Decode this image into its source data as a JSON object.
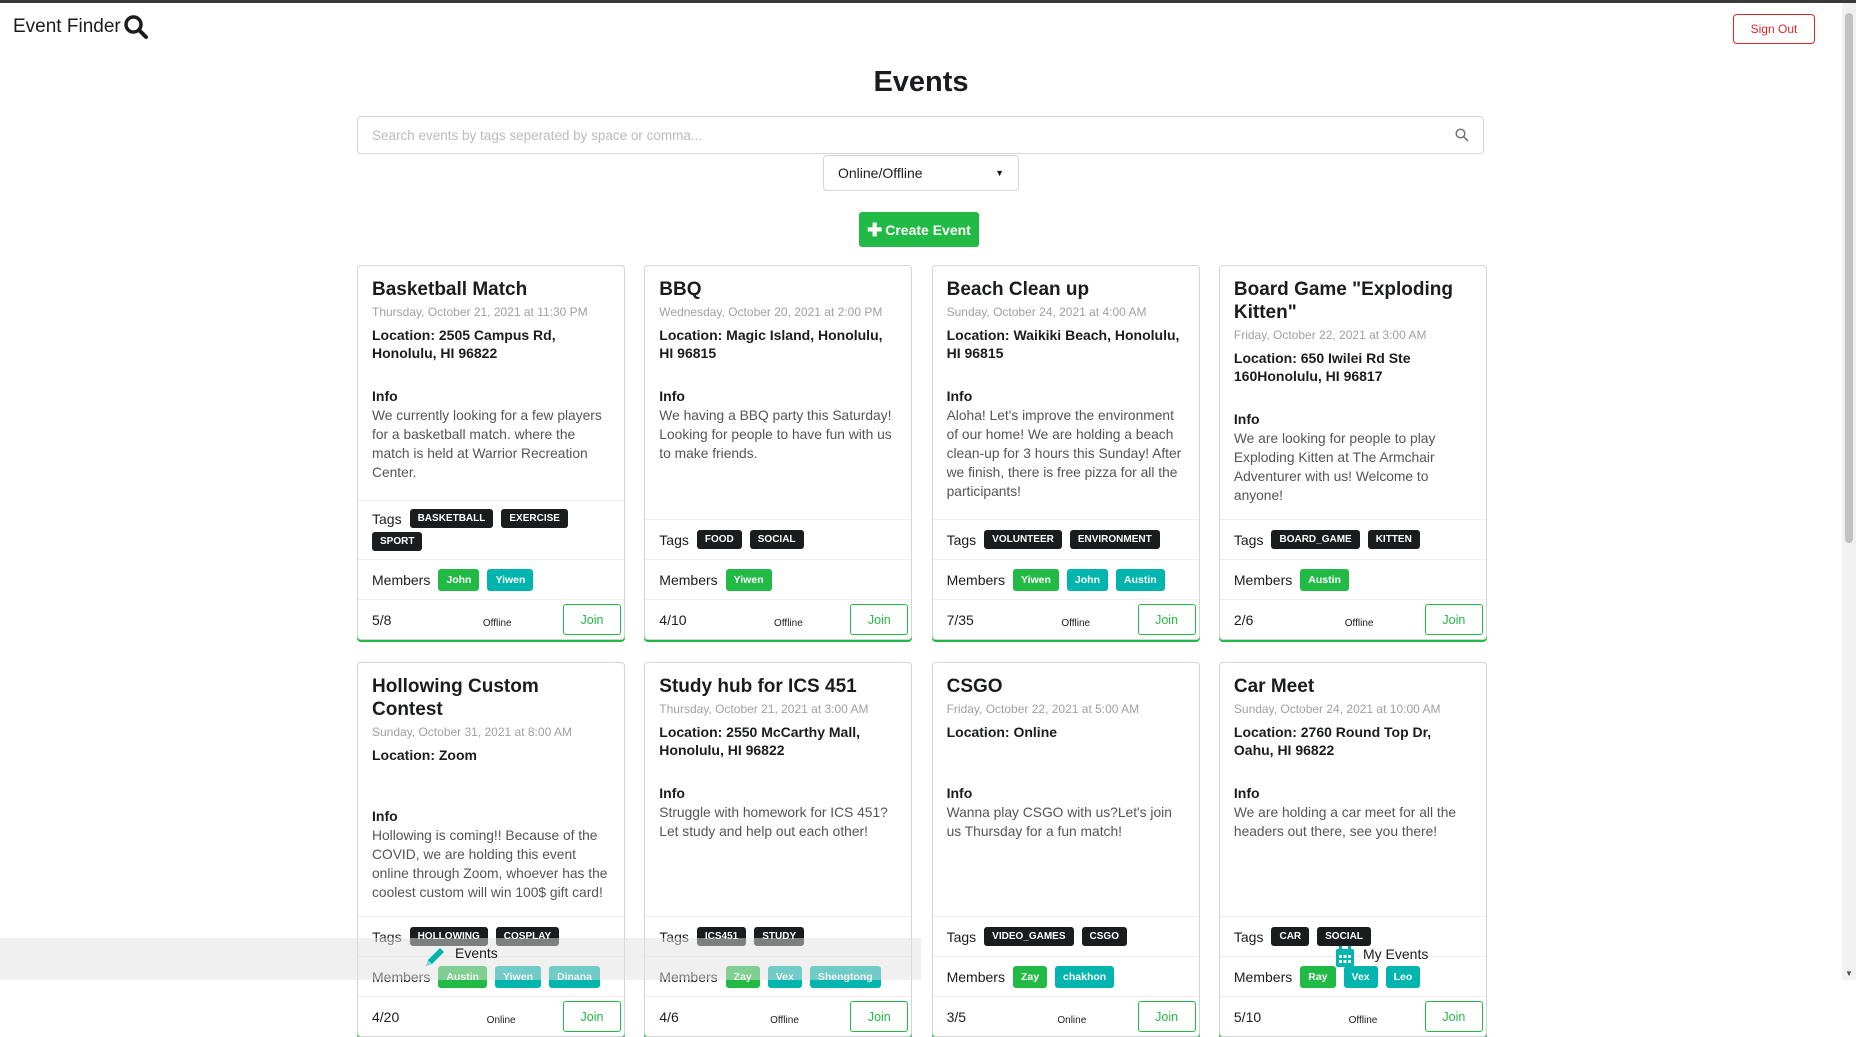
{
  "header": {
    "brand": "Event Finder",
    "sign_out": "Sign Out"
  },
  "page_title": "Events",
  "search": {
    "placeholder": "Search events by tags seperated by space or comma...",
    "value": ""
  },
  "filter": {
    "selected": "Online/Offline"
  },
  "create_button": "Create Event",
  "labels": {
    "info": "Info",
    "tags": "Tags",
    "members": "Members",
    "join": "Join"
  },
  "colors": {
    "green": "#21ba45",
    "teal": "#00b5ad",
    "red": "#db2828",
    "tag": "#1b1c1d"
  },
  "events": [
    {
      "title": "Basketball Match",
      "date": "Thursday, October 21, 2021 at 11:30 PM",
      "location": "Location: 2505 Campus Rd, Honolulu, HI 96822",
      "info": "We currently looking for a few players for a basketball match. where the match is held at Warrior Recreation Center.",
      "tags": [
        "BASKETBALL",
        "EXERCISE",
        "SPORT"
      ],
      "members": [
        "John",
        "Yiwen"
      ],
      "count": "5/8",
      "mode": "Offline"
    },
    {
      "title": "BBQ",
      "date": "Wednesday, October 20, 2021 at 2:00 PM",
      "location": "Location: Magic Island, Honolulu, HI 96815",
      "info": "We having a BBQ party this Saturday! Looking for people to have fun with us to make friends.",
      "tags": [
        "FOOD",
        "SOCIAL"
      ],
      "members": [
        "Yiwen"
      ],
      "count": "4/10",
      "mode": "Offline"
    },
    {
      "title": "Beach Clean up",
      "date": "Sunday, October 24, 2021 at 4:00 AM",
      "location": "Location: Waikiki Beach, Honolulu, HI 96815",
      "info": "Aloha! Let's improve the environment of our home! We are holding a beach clean-up for 3 hours this Sunday! After we finish, there is free pizza for all the participants!",
      "tags": [
        "VOLUNTEER",
        "ENVIRONMENT"
      ],
      "members": [
        "Yiwen",
        "John",
        "Austin"
      ],
      "count": "7/35",
      "mode": "Offline"
    },
    {
      "title": "Board Game \"Exploding Kitten\"",
      "date": "Friday, October 22, 2021 at 3:00 AM",
      "location": "Location: 650 Iwilei Rd Ste 160Honolulu, HI 96817",
      "info": "We are looking for people to play Exploding Kitten at The Armchair Adventurer with us! Welcome to anyone!",
      "tags": [
        "BOARD_GAME",
        "KITTEN"
      ],
      "members": [
        "Austin"
      ],
      "count": "2/6",
      "mode": "Offline"
    },
    {
      "title": "Hollowing Custom Contest",
      "date": "Sunday, October 31, 2021 at 8:00 AM",
      "location": "Location: Zoom",
      "info": "Hollowing is coming!! Because of the COVID, we are holding this event online through Zoom, whoever has the coolest custom will win 100$ gift card!",
      "tags": [
        "HOLLOWING",
        "COSPLAY"
      ],
      "members": [
        "Austin",
        "Yiwen",
        "Dinana"
      ],
      "count": "4/20",
      "mode": "Online"
    },
    {
      "title": "Study hub for ICS 451",
      "date": "Thursday, October 21, 2021 at 3:00 AM",
      "location": "Location: 2550 McCarthy Mall, Honolulu, HI 96822",
      "info": "Struggle with homework for ICS 451? Let study and help out each other!",
      "tags": [
        "ICS451",
        "STUDY"
      ],
      "members": [
        "Zay",
        "Vex",
        "Shengtong"
      ],
      "count": "4/6",
      "mode": "Offline"
    },
    {
      "title": "CSGO",
      "date": "Friday, October 22, 2021 at 5:00 AM",
      "location": "Location: Online",
      "info": "Wanna play CSGO with us?Let's join us Thursday for a fun match!",
      "tags": [
        "VIDEO_GAMES",
        "CSGO"
      ],
      "members": [
        "Zay",
        "chakhon"
      ],
      "count": "3/5",
      "mode": "Online"
    },
    {
      "title": "Car Meet",
      "date": "Sunday, October 24, 2021 at 10:00 AM",
      "location": "Location: 2760 Round Top Dr, Oahu, HI 96822",
      "info": "We are holding a car meet for all the headers out there, see you there!",
      "tags": [
        "CAR",
        "SOCIAL"
      ],
      "members": [
        "Ray",
        "Vex",
        "Leo"
      ],
      "count": "5/10",
      "mode": "Offline"
    }
  ],
  "bottom_nav": {
    "events": "Events",
    "my_events": "My Events"
  }
}
